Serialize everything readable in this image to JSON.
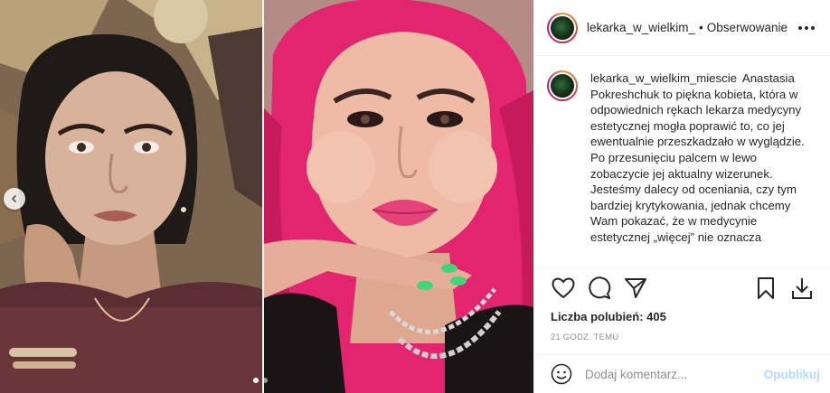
{
  "post": {
    "header": {
      "username": "lekarka_w_wielkim_miescie",
      "separator": "•",
      "follow_label": "Obserwowanie"
    },
    "caption": {
      "username": "lekarka_w_wielkim_miescie",
      "text": "Anastasia Pokreshchuk to piękna kobieta, która w odpowiednich rękach lekarza medycyny estetycznej mogła poprawić to, co jej ewentualnie przeszkadzało w wyglądzie. Po przesunięciu palcem w lewo zobaczycie jej aktualny wizerunek. Jesteśmy dalecy od oceniania, czy tym bardziej krytykowania, jednak chcemy Wam pokazać, że w medycynie estetycznej „więcej” nie oznacza"
    },
    "likes": "Liczba polubień: 405",
    "time": "21 GODZ. TEMU",
    "comment": {
      "placeholder": "Dodaj komentarz...",
      "post_label": "Opublikuj"
    }
  },
  "carousel": {
    "slide_count": 2,
    "active_index": 0
  },
  "colors": {
    "post_button": "#b3dbff",
    "border": "#efefef",
    "muted_text": "#8e8e8e"
  },
  "icons": [
    "chevron-left-icon",
    "more-icon",
    "heart-icon",
    "comment-icon",
    "share-icon",
    "bookmark-icon",
    "download-icon",
    "emoji-icon"
  ]
}
